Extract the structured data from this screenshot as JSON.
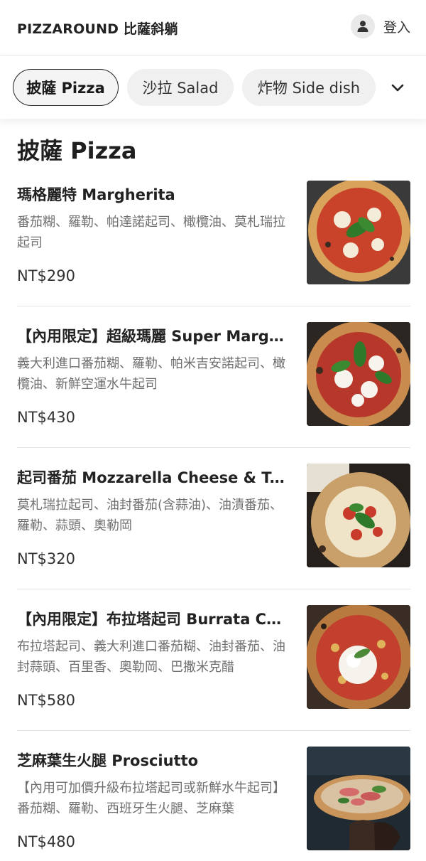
{
  "header": {
    "brand": "PIZZAROUND 比薩斜躺",
    "login_label": "登入",
    "login_icon": "user-icon"
  },
  "tabs": [
    {
      "label": "披薩 Pizza",
      "active": true
    },
    {
      "label": "沙拉 Salad",
      "active": false
    },
    {
      "label": "炸物 Side dish",
      "active": false
    }
  ],
  "tabs_toggle_icon": "chevron-down-icon",
  "section": {
    "title": "披薩 Pizza"
  },
  "items": [
    {
      "name": "瑪格麗特 Margherita",
      "description": "番茄糊、羅勒、帕達諾起司、橄欖油、莫札瑞拉起司",
      "price": "NT$290"
    },
    {
      "name": "【內用限定】超級瑪麗 Super Margherita",
      "description": "義大利進口番茄糊、羅勒、帕米吉安諾起司、橄欖油、新鮮空運水牛起司",
      "price": "NT$430"
    },
    {
      "name": "起司番茄 Mozzarella Cheese & Tomato",
      "description": "莫札瑞拉起司、油封番茄(含蒜油)、油漬番茄、羅勒、蒜頭、奧勒岡",
      "price": "NT$320"
    },
    {
      "name": "【內用限定】布拉塔起司 Burrata Cheese",
      "description": "布拉塔起司、義大利進口番茄糊、油封番茄、油封蒜頭、百里香、奧勒岡、巴撒米克醋",
      "price": "NT$580"
    },
    {
      "name": "芝麻葉生火腿 Prosciutto",
      "description": "【內用可加價升級布拉塔起司或新鮮水牛起司】番茄糊、羅勒、西班牙生火腿、芝麻葉",
      "price": "NT$480"
    }
  ]
}
